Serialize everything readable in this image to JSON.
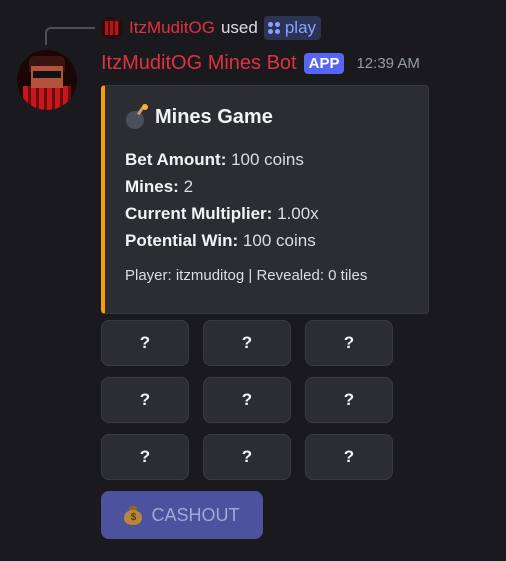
{
  "reply": {
    "username": "ItzMuditOG",
    "used_text": "used",
    "command": "play"
  },
  "message": {
    "bot_name": "ItzMuditOG Mines Bot",
    "app_tag": "APP",
    "timestamp": "12:39 AM"
  },
  "embed": {
    "accent_color": "#f5a00b",
    "title": "Mines Game",
    "fields": [
      {
        "label": "Bet Amount:",
        "value": "100 coins"
      },
      {
        "label": "Mines:",
        "value": "2"
      },
      {
        "label": "Current Multiplier:",
        "value": "1.00x"
      },
      {
        "label": "Potential Win:",
        "value": "100 coins"
      }
    ],
    "footer": "Player: itzmuditog | Revealed: 0 tiles"
  },
  "grid": {
    "tiles": [
      "?",
      "?",
      "?",
      "?",
      "?",
      "?",
      "?",
      "?",
      "?"
    ]
  },
  "cashout": {
    "label": "CASHOUT",
    "icon": "money-bag-icon"
  },
  "colors": {
    "username": "#e0323d",
    "app_tag_bg": "#5865f2",
    "command_chip": "#8aa1ff",
    "cashout_bg": "#4c529e"
  }
}
